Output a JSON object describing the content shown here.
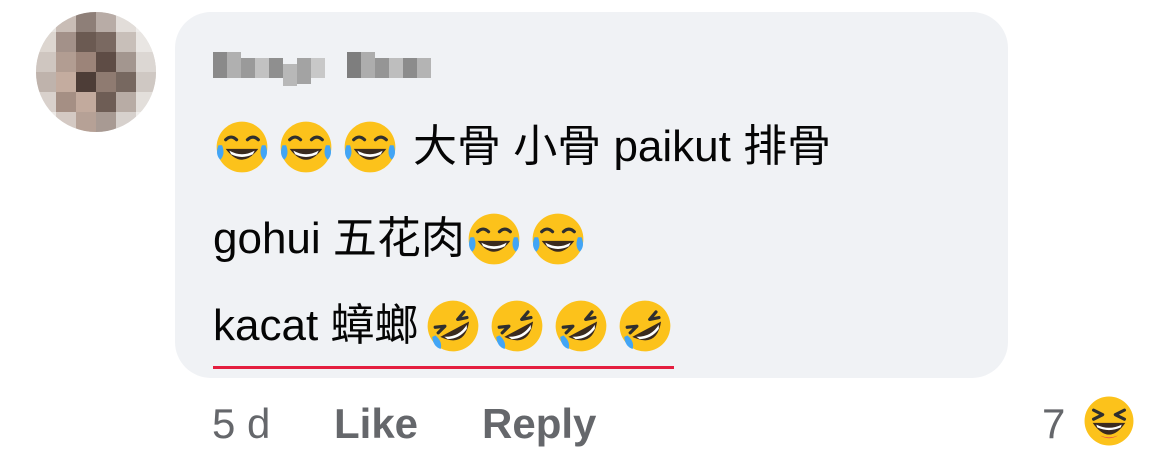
{
  "comment": {
    "author_name": "",
    "line1": {
      "emoji_before": [
        "joy",
        "joy",
        "joy"
      ],
      "text": "大骨 小骨 paikut 排骨"
    },
    "line2": {
      "text": "gohui 五花肉",
      "emoji_after": [
        "joy",
        "joy"
      ]
    },
    "line3": {
      "text": "kacat 蟑螂",
      "emoji_after": [
        "rofl",
        "rofl",
        "rofl",
        "rofl"
      ],
      "spellcheck_underline_color": "#e41e3f"
    }
  },
  "actions": {
    "time": "5 d",
    "like_label": "Like",
    "reply_label": "Reply"
  },
  "reactions": {
    "count": "7",
    "icon": "laughing-face-icon"
  },
  "colors": {
    "bubble_bg": "#f0f2f5",
    "text": "#050505",
    "secondary_text": "#65676b",
    "emoji_yellow": "#fcc21b"
  }
}
